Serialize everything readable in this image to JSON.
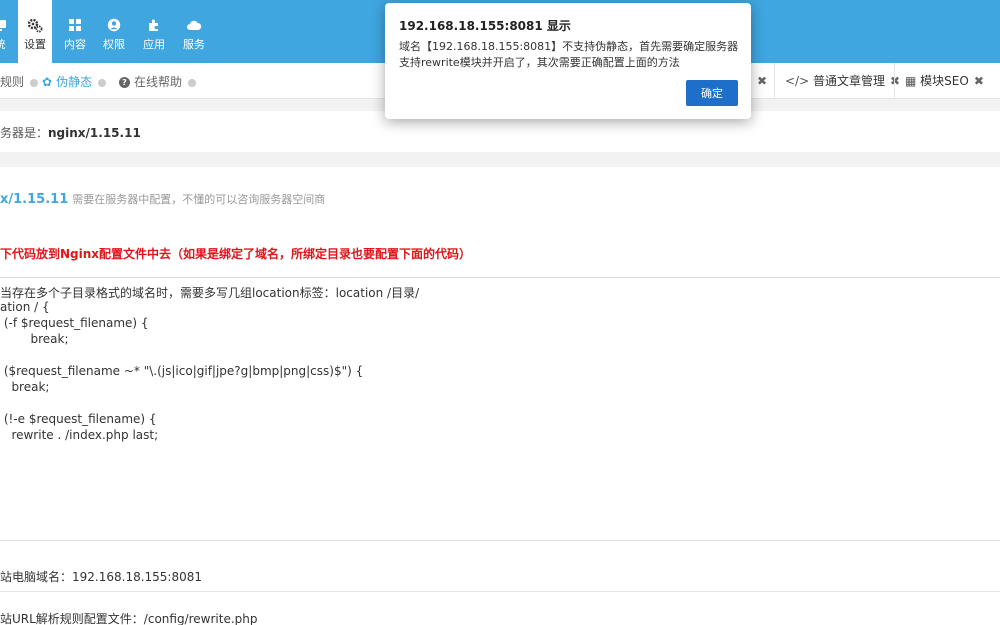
{
  "nav": {
    "items": [
      {
        "label": "统",
        "icon": "monitor-icon"
      },
      {
        "label": "设置",
        "icon": "gears-icon"
      },
      {
        "label": "内容",
        "icon": "grid-icon"
      },
      {
        "label": "权限",
        "icon": "user-icon"
      },
      {
        "label": "应用",
        "icon": "puzzle-icon"
      },
      {
        "label": "服务",
        "icon": "cloud-icon"
      }
    ],
    "active_index": 1
  },
  "tabs": {
    "left": [
      {
        "label": "规则"
      },
      {
        "label": "伪静态"
      },
      {
        "label": "在线帮助"
      }
    ],
    "right": [
      {
        "label": "普通文章管理",
        "icon": "code-icon"
      },
      {
        "label": "模块SEO",
        "icon": "grid-icon"
      }
    ]
  },
  "server": {
    "prefix": "务器是：",
    "value": "nginx/1.15.11"
  },
  "version": {
    "label": "x/1.15.11",
    "hint": "需要在服务器中配置，不懂的可以咨询服务器空间商"
  },
  "warning": "下代码放到Nginx配置文件中去（如果是绑定了域名，所绑定目录也要配置下面的代码）",
  "code_lines": [
    "当存在多个子目录格式的域名时，需要多写几组location标签：location /目录/",
    "ation / {",
    " (-f $request_filename) {",
    "        break;",
    "",
    " ($request_filename ~* \"\\.(js|ico|gif|jpe?g|bmp|png|css)$\") {",
    "   break;",
    "",
    " (!-e $request_filename) {",
    "   rewrite . /index.php last;"
  ],
  "bottom": {
    "domain_line": "站电脑域名：192.168.18.155:8081",
    "config_line": "站URL解析规则配置文件：/config/rewrite.php"
  },
  "dialog": {
    "title": "192.168.18.155:8081 显示",
    "message": "域名【192.168.18.155:8081】不支持伪静态，首先需要确定服务器支持rewrite模块并开启了，其次需要正确配置上面的方法",
    "ok_label": "确定"
  },
  "colors": {
    "nav_bg": "#3fa6e0",
    "accent": "#3fa6e0",
    "warning": "#e0151a",
    "dialog_button": "#1e6fc9"
  }
}
